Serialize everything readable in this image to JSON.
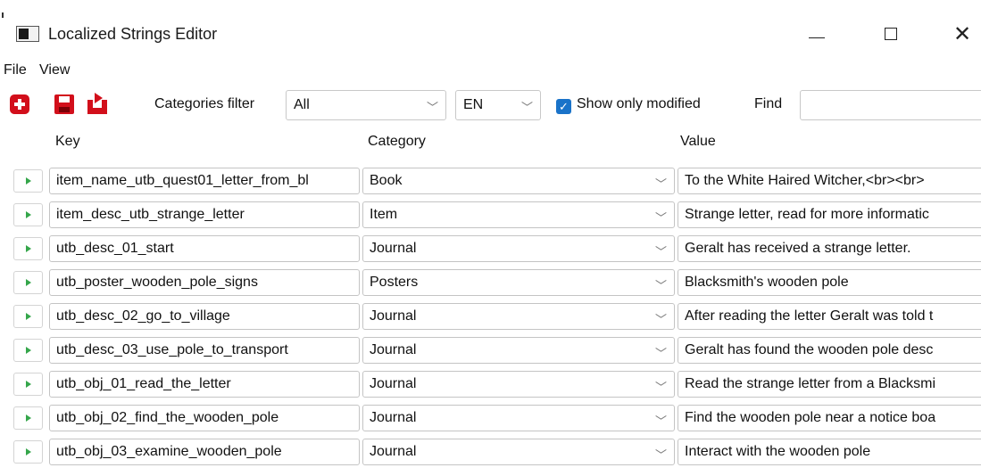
{
  "window": {
    "title": "Localized Strings Editor",
    "controls": {
      "minimize": "—",
      "maximize": "□",
      "close": "✕"
    }
  },
  "menu": [
    "File",
    "View"
  ],
  "toolbar": {
    "icons": [
      "add-icon",
      "save-icon",
      "reload-icon"
    ],
    "categories_filter_label": "Categories filter",
    "category_value": "All",
    "language_value": "EN",
    "show_only_modified_label": "Show only modified",
    "show_only_modified_checked": true,
    "find_label": "Find",
    "find_value": ""
  },
  "columns": {
    "key": "Key",
    "category": "Category",
    "value": "Value"
  },
  "rows": [
    {
      "key": "item_name_utb_quest01_letter_from_bl",
      "category": "Book",
      "value": "To the White Haired Witcher,<br><br>"
    },
    {
      "key": "item_desc_utb_strange_letter",
      "category": "Item",
      "value": "Strange letter, read for more informatic"
    },
    {
      "key": "utb_desc_01_start",
      "category": "Journal",
      "value": "Geralt has received a strange letter."
    },
    {
      "key": "utb_poster_wooden_pole_signs",
      "category": "Posters",
      "value": "Blacksmith's wooden pole"
    },
    {
      "key": "utb_desc_02_go_to_village",
      "category": "Journal",
      "value": "After reading the letter Geralt was told t"
    },
    {
      "key": "utb_desc_03_use_pole_to_transport",
      "category": "Journal",
      "value": "Geralt has found the wooden pole desc"
    },
    {
      "key": "utb_obj_01_read_the_letter",
      "category": "Journal",
      "value": "Read the strange letter from a Blacksmi"
    },
    {
      "key": "utb_obj_02_find_the_wooden_pole",
      "category": "Journal",
      "value": "Find the wooden pole near a notice boa"
    },
    {
      "key": "utb_obj_03_examine_wooden_pole",
      "category": "Journal",
      "value": "Interact with the wooden pole"
    }
  ],
  "colors": {
    "accent_red": "#d20f1b",
    "checkbox_blue": "#1a73c9",
    "expand_green": "#35a64b"
  }
}
